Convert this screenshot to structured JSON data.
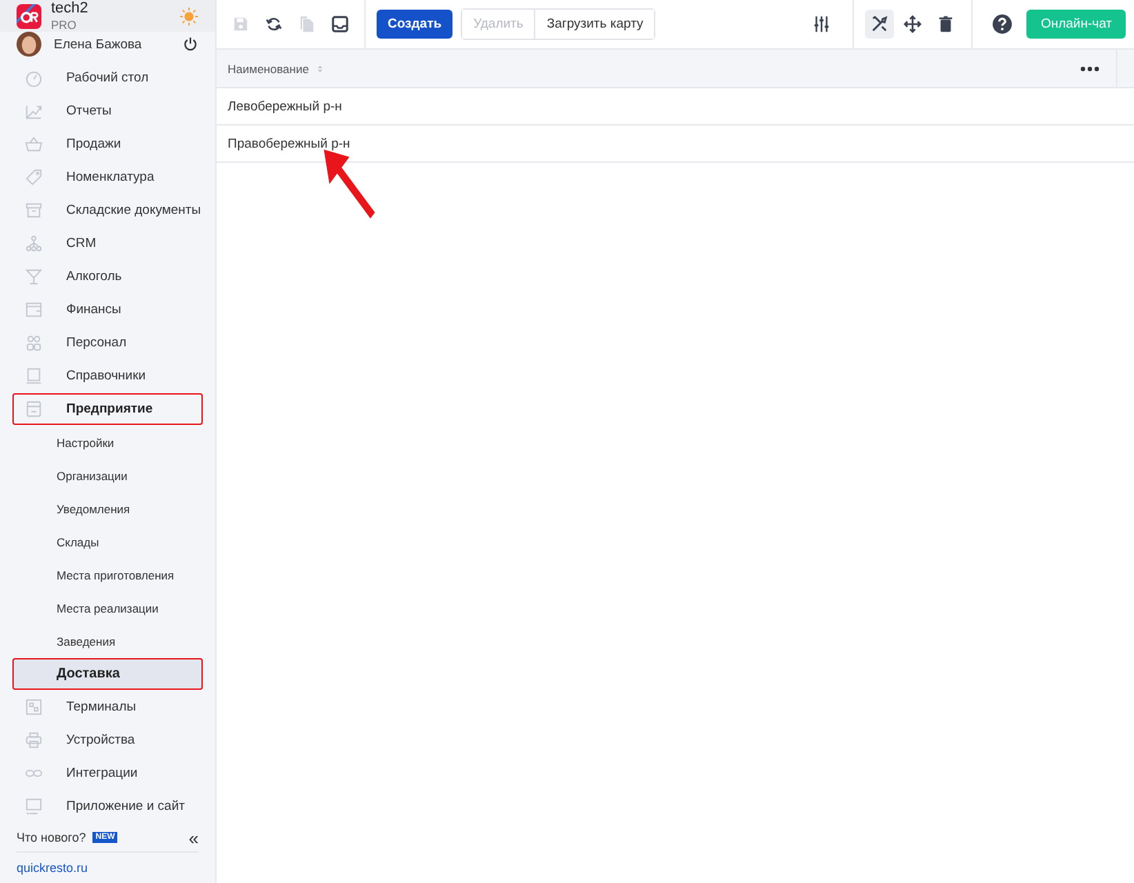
{
  "app": {
    "name": "tech2",
    "plan": "PRO"
  },
  "user": {
    "name": "Елена Бажова"
  },
  "sidebar": {
    "items": [
      {
        "label": "Рабочий стол",
        "selected": false,
        "highlighted": false
      },
      {
        "label": "Отчеты",
        "selected": false,
        "highlighted": false
      },
      {
        "label": "Продажи",
        "selected": false,
        "highlighted": false
      },
      {
        "label": "Номенклатура",
        "selected": false,
        "highlighted": false
      },
      {
        "label": "Складские документы",
        "selected": false,
        "highlighted": false
      },
      {
        "label": "CRM",
        "selected": false,
        "highlighted": false
      },
      {
        "label": "Алкоголь",
        "selected": false,
        "highlighted": false
      },
      {
        "label": "Финансы",
        "selected": false,
        "highlighted": false
      },
      {
        "label": "Персонал",
        "selected": false,
        "highlighted": false
      },
      {
        "label": "Справочники",
        "selected": false,
        "highlighted": false
      },
      {
        "label": "Предприятие",
        "selected": false,
        "highlighted": true,
        "children": [
          {
            "label": "Настройки",
            "selected": false,
            "highlighted": false
          },
          {
            "label": "Организации",
            "selected": false,
            "highlighted": false
          },
          {
            "label": "Уведомления",
            "selected": false,
            "highlighted": false
          },
          {
            "label": "Склады",
            "selected": false,
            "highlighted": false
          },
          {
            "label": "Места приготовления",
            "selected": false,
            "highlighted": false
          },
          {
            "label": "Места реализации",
            "selected": false,
            "highlighted": false
          },
          {
            "label": "Заведения",
            "selected": false,
            "highlighted": false
          },
          {
            "label": "Доставка",
            "selected": true,
            "highlighted": true
          }
        ]
      },
      {
        "label": "Терминалы",
        "selected": false,
        "highlighted": false
      },
      {
        "label": "Устройства",
        "selected": false,
        "highlighted": false
      },
      {
        "label": "Интеграции",
        "selected": false,
        "highlighted": false
      },
      {
        "label": "Приложение и сайт",
        "selected": false,
        "highlighted": false
      }
    ],
    "whats_new": "Что нового?",
    "new_badge": "NEW",
    "collapse_glyph": "«",
    "site_link": "quickresto.ru"
  },
  "toolbar": {
    "icon_buttons": [
      {
        "kind": "save",
        "disabled": true
      },
      {
        "kind": "refresh",
        "disabled": false
      },
      {
        "kind": "copy",
        "disabled": true
      },
      {
        "kind": "inbox",
        "disabled": false
      }
    ],
    "create": "Создать",
    "delete": {
      "label": "Удалить",
      "disabled": true
    },
    "upload": "Загрузить карту",
    "tool_buttons": [
      {
        "kind": "sliders",
        "selected": false
      },
      {
        "kind": "tools",
        "selected": true
      },
      {
        "kind": "move",
        "selected": false
      },
      {
        "kind": "trash",
        "selected": false
      }
    ],
    "chat": "Онлайн-чат"
  },
  "table": {
    "columns": [
      "Наименование"
    ],
    "rows": [
      [
        "Левобережный р-н"
      ],
      [
        "Правобережный р-н"
      ]
    ]
  },
  "annotation_arrow": true
}
